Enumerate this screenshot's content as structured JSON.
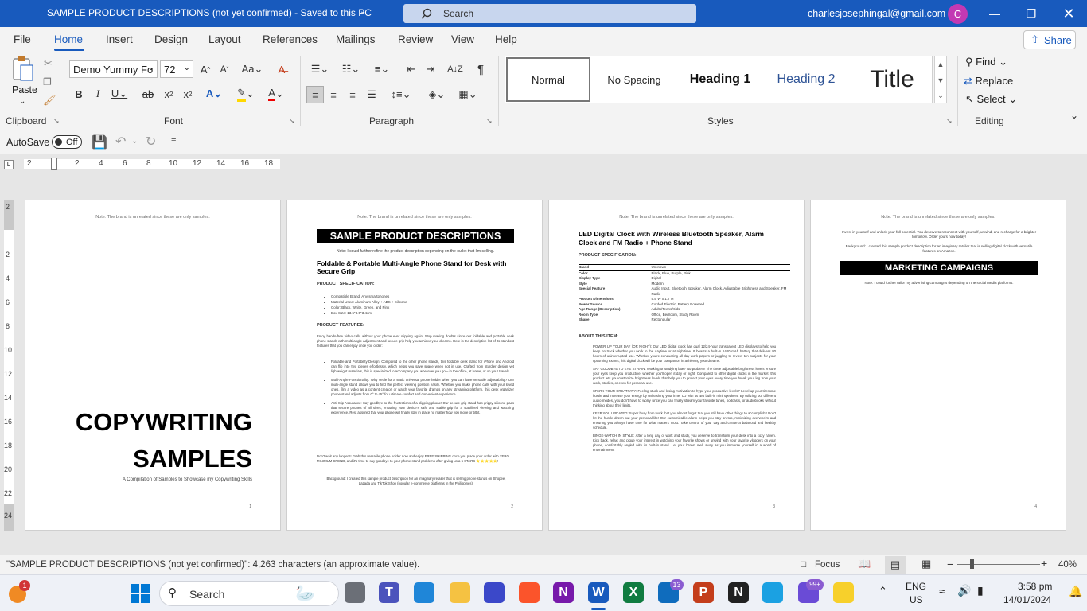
{
  "titlebar": {
    "doc_title": "SAMPLE PRODUCT DESCRIPTIONS (not yet confirmed)  -  Saved to this PC",
    "search_placeholder": "Search",
    "account": "charlesjosephingal@gmail.com",
    "avatar_initial": "C"
  },
  "menu": {
    "tabs": [
      "File",
      "Home",
      "Insert",
      "Design",
      "Layout",
      "References",
      "Mailings",
      "Review",
      "View",
      "Help"
    ],
    "active": "Home",
    "share": "Share"
  },
  "ribbon": {
    "clipboard": {
      "paste": "Paste",
      "label": "Clipboard"
    },
    "font": {
      "name": "Demo Yummy Fo",
      "size": "72",
      "label": "Font"
    },
    "paragraph": {
      "label": "Paragraph"
    },
    "styles": {
      "items": [
        "Normal",
        "No Spacing",
        "Heading 1",
        "Heading 2",
        "Title"
      ],
      "label": "Styles"
    },
    "editing": {
      "find": "Find",
      "replace": "Replace",
      "select": "Select",
      "label": "Editing"
    }
  },
  "qat": {
    "autosave": "AutoSave",
    "toggle": "Off"
  },
  "ruler": {
    "ticks": [
      "2",
      "2",
      "4",
      "6",
      "8",
      "10",
      "12",
      "14",
      "16",
      "18"
    ]
  },
  "vruler": {
    "ticks": [
      "2",
      "2",
      "4",
      "6",
      "8",
      "10",
      "12",
      "14",
      "16",
      "18",
      "20",
      "22",
      "24"
    ]
  },
  "pages": {
    "note": "Note: The brand is unrelated since these are only samples.",
    "p1": {
      "title_line1": "COPYWRITING",
      "title_line2": "SAMPLES",
      "subtitle": "A Compilation of Samples to Showcase my Copywriting Skills",
      "num": "1"
    },
    "p2": {
      "banner": "SAMPLE PRODUCT DESCRIPTIONS",
      "note2": "Note: I could further refine the product description depending on the outlet that I'm selling.",
      "heading": "Foldable & Portable Multi-Angle Phone Stand for Desk with Secure Grip",
      "spec_h": "PRODUCT SPECIFICATION:",
      "specs": [
        "Compatible Brand: Any smartphones",
        "Material Used: Aluminum Alloy + ABS + Silicone",
        "Color: Black, White, Green, and Pink",
        "Box Size: 13.5*8.5*3.4cm"
      ],
      "feat_h": "PRODUCT FEATURES:",
      "intro": "Enjoy hands-free video calls without your phone ever slipping again. Stop making doubts since our foldable and portable desk phone stands with multi-angle adjustment and secure grip help you achieve your dreams. Here is the descriptive list of its standout features that you can enjoy once you order:",
      "features": [
        "Foldable and Portability Design: Compared to the other phone stands, this foldable desk stand for iPhone and Android can flip into two pieces effortlessly, which helps you save space when not in use. Crafted from sturdier design yet lightweight materials, this is specialized to accompany you wherever you go – in the office, at home, or on your travels.",
        "Multi-Angle Functionality: Why settle for a static universal phone holder when you can have versatile adjustability? Our multi-angle stand allows you to find the perfect viewing position easily. Whether you make phone calls with your loved ones, film a video as a content creator, or watch your favorite dramas on any streaming platform, this desk organizer phone stand adjusts from 0° to 45° for ultimate comfort and convenient experience.",
        "Anti-Slip Assurance: Say goodbye to the frustrations of a slipping phone! Our secure grip stand has grippy silicone pads that secure phones of all sizes, ensuring your device's safe and stable grip for a stabilized viewing and watching experience. Rest assured that your phone will finally stay in place no matter how you move or tilt it."
      ],
      "closing": "Don't wait any longer!!! Grab this versatile phone holder now and enjoy FREE SHIPPING once you place your order with ZERO MINIMUM SPEND, and it's time to say goodbye to your phone stand problems after giving us a 5 STARS ⭐⭐⭐⭐⭐!",
      "background": "Background: I created this sample product description for an imaginary retailer that is selling phone stands on Shopee, Lazada and TikTok Shop (popular e-commerce platforms in the Philippines).",
      "num": "2"
    },
    "p3": {
      "heading": "LED Digital Clock with Wireless Bluetooth Speaker, Alarm Clock and FM Radio + Phone Stand",
      "spec_h": "PRODUCT SPECIFICATION:",
      "table": [
        [
          "Brand",
          "Unknown"
        ],
        [
          "Color",
          "Black, Blue, Purple, Pink"
        ],
        [
          "Display Type",
          "Digital"
        ],
        [
          "Style",
          "Modern"
        ],
        [
          "Special Feature",
          "Audio Input, Bluetooth Speaker, Alarm Clock, Adjustable Brightness and Speaker, FM Radio"
        ],
        [
          "Product Dimensions",
          "5.5\"W x 1.7\"H"
        ],
        [
          "Power Source",
          "Corded Electric, Battery Powered"
        ],
        [
          "Age Range (Description)",
          "Adults/Teens/Kids"
        ],
        [
          "Room Type",
          "Office, Bedroom, Study Room"
        ],
        [
          "Shape",
          "Rectangular"
        ]
      ],
      "about_h": "ABOUT THIS ITEM:",
      "items": [
        "POWER UP YOUR DAY (OR NIGHT): Our LED digital clock has dual 12/24-hour transparent LED displays to help you keep on track whether you work in the daytime or at nighttime. It boasts a built-in 1400 mAh battery that delivers 80 hours of uninterrupted use. Whether you're conquering all-day work papers or juggling to review ten subjects for your upcoming exams, this digital clock will be your companion in achieving your dreams.",
        "SAY GOODBYE TO EYE STRAIN: Working or studying late? No problem! The three adjustable brightness levels ensure your eyes keep you productive, whether you'll open it day or night. Compared to other digital clocks in the market, this product lets you customize brightness levels that help you to protect your eyes every time you break your leg from your work, studies, or even for personal use.",
        "SPARK YOUR CREATIVITY: Feeling stuck and losing motivation to hype your productive levels? Level up your tiresome hustle and increase your energy by unleashing your inner DJ with its two built-in mini speakers. By utilizing our different audio modes, you don't have to worry since you can finally stream your favorite tunes, podcasts, or audiobooks without thinking about their limits.",
        "KEEP YOU UPDATED: Super busy from work that you almost forgot that you still have other things to accomplish? Don't let the hustle drown out your personal life! Our customizable alarm helps you stay on top, minimizing overwhelm and ensuring you always have time for what matters most. Take control of your day and create a balanced and healthy schedule.",
        "BINGE-WATCH IN STYLE: After a long day of work and study, you deserve to transform your desk into a cozy haven. Kick back, relax, and pique your interest in watching your favorite shows or unwind with your favorite vloggers on your phone, comfortably angled with its built-in stand. Let your brown melt away as you immerse yourself in a world of entertainment."
      ],
      "num": "3"
    },
    "p4": {
      "intro": "Invest in yourself and unlock your full potential. You deserve to reconnect with yourself, unwind, and recharge for a brighter tomorrow. Order yours now today!",
      "background": "Background: I created this sample product description for an imaginary retailer that is selling digital clock with versatile features on Amazon.",
      "banner": "MARKETING CAMPAIGNS",
      "note2": "Note: I could further tailor my advertising campaigns depending on the social media platforms.",
      "num": "4"
    }
  },
  "status": {
    "text": "\"SAMPLE PRODUCT DESCRIPTIONS (not yet confirmed)\": 4,263 characters (an approximate value).",
    "focus": "Focus",
    "zoom": "40%"
  },
  "taskbar": {
    "search": "Search",
    "teams_badge": "13",
    "lang1": "ENG",
    "lang2": "US",
    "time": "3:58 pm",
    "date": "14/01/2024",
    "notif_badge": "1",
    "mail_badge": "99+"
  }
}
